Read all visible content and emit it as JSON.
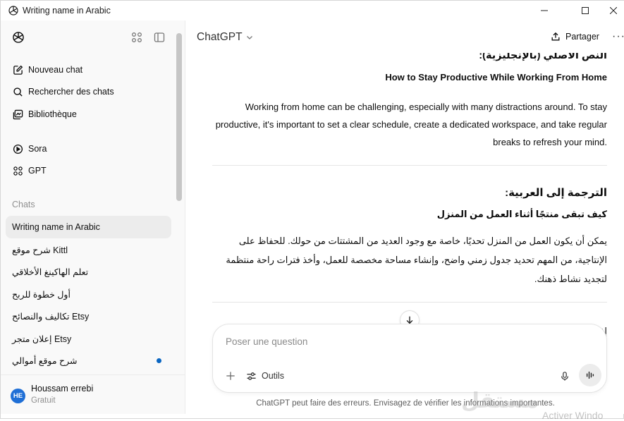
{
  "window": {
    "title": "Writing name in Arabic"
  },
  "sidebar": {
    "logo_icon": "chatgpt-logo-icon",
    "nav": [
      {
        "label": "Nouveau chat",
        "icon": "new-chat-icon"
      },
      {
        "label": "Rechercher des chats",
        "icon": "search-icon"
      },
      {
        "label": "Bibliothèque",
        "icon": "library-icon"
      },
      {
        "label": "Sora",
        "icon": "play-circle-icon"
      },
      {
        "label": "GPT",
        "icon": "grid-icon"
      }
    ],
    "section_label": "Chats",
    "chats": [
      {
        "label": "Writing name in Arabic",
        "active": true
      },
      {
        "label": "شرح موقع Kittl"
      },
      {
        "label": "تعلم الهاكينغ الأخلاقي"
      },
      {
        "label": "أول خطوة للربح"
      },
      {
        "label": "تكاليف والنصائح Etsy"
      },
      {
        "label": "إعلان متجر Etsy"
      },
      {
        "label": "شرح موقع أموالي",
        "unread": true
      }
    ],
    "user": {
      "initials": "HE",
      "name": "Houssam errebi",
      "plan": "Gratuit"
    }
  },
  "header": {
    "model": "ChatGPT",
    "share_label": "Partager",
    "more_label": "···"
  },
  "conversation": {
    "original_heading": "النص الأصلي (بالإنجليزية):",
    "original_title": "How to Stay Productive While Working From Home",
    "original_body": "Working from home can be challenging, especially with many distractions around. To stay productive, it's important to set a clear schedule, create a dedicated workspace, and take regular breaks to refresh your mind.",
    "arabic_heading": "الترجمة إلى العربية:",
    "arabic_title": "كيف تبقى منتجًا أثناء العمل من المنزل",
    "arabic_body": "يمكن أن يكون العمل من المنزل تحديًا، خاصة مع وجود العديد من المشتتات من حولك. للحفاظ على الإنتاجية، من المهم تحديد جدول زمني واضح، وإنشاء مساحة مخصصة للعمل، وأخذ فترات راحة منتظمة لتجديد نشاط ذهنك.",
    "partial_text": "إذا"
  },
  "composer": {
    "placeholder": "Poser une question",
    "tools_label": "Outils"
  },
  "disclaimer": "ChatGPT peut faire des erreurs. Envisagez de vérifier les informations importantes.",
  "watermark": "مستقل",
  "activate_text": "Activer Windo",
  "colors": {
    "sidebar_bg": "#f9f9f9",
    "active_chat_bg": "#ececec",
    "avatar_bg": "#1f6fd6",
    "unread_dot": "#0a66c2"
  }
}
